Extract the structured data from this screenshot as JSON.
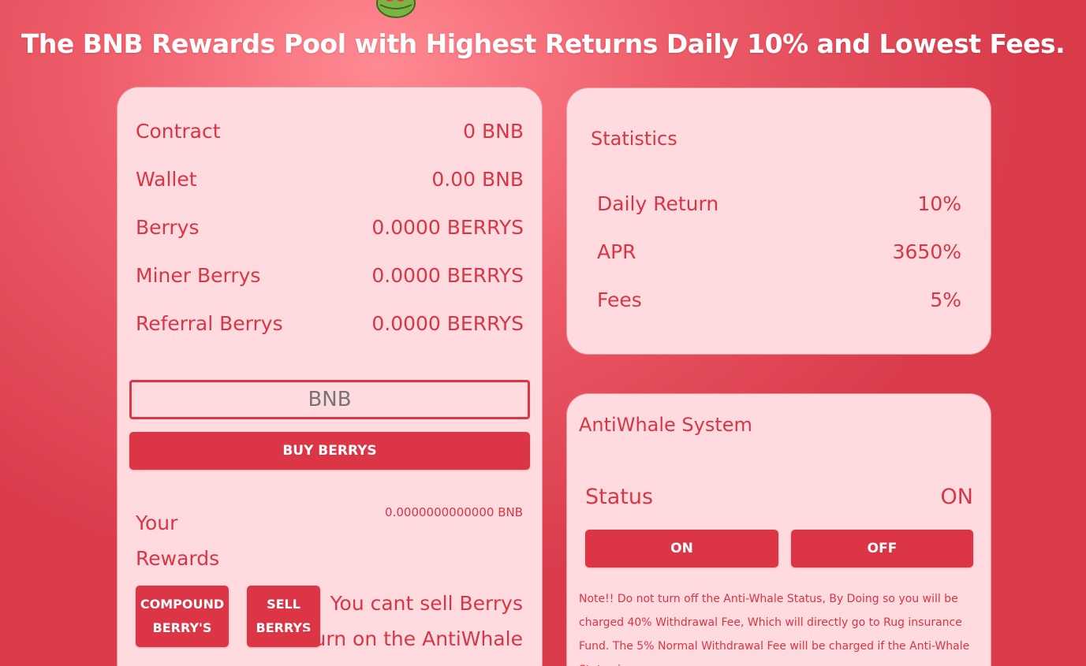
{
  "header": {
    "logo_icon": "berry-basket-logo-icon",
    "headline": "The BNB Rewards Pool with Highest Returns Daily 10% and Lowest Fees."
  },
  "main": {
    "rows": [
      {
        "label": "Contract",
        "value": "0 BNB"
      },
      {
        "label": "Wallet",
        "value": "0.00 BNB"
      },
      {
        "label": "Berrys",
        "value": "0.0000 BERRYS"
      },
      {
        "label": "Miner Berrys",
        "value": "0.0000 BERRYS"
      },
      {
        "label": "Referral Berrys",
        "value": "0.0000 BERRYS"
      }
    ],
    "bnb_input_placeholder": "BNB",
    "buy_button": "BUY BERRYS",
    "rewards_label": "Your Rewards",
    "rewards_value": "0.0000000000000 BNB",
    "compound_button": "COMPOUND BERRY'S",
    "sell_button": "SELL BERRYS",
    "sell_warning_line1": "You cant sell Berrys",
    "sell_warning_line2": "Turn on the AntiWhale"
  },
  "statistics": {
    "title": "Statistics",
    "rows": [
      {
        "label": "Daily Return",
        "value": "10%"
      },
      {
        "label": "APR",
        "value": "3650%"
      },
      {
        "label": "Fees",
        "value": "5%"
      }
    ]
  },
  "antiwhale": {
    "title": "AntiWhale System",
    "status_label": "Status",
    "status_value": "ON",
    "on_button": "ON",
    "off_button": "OFF",
    "note": "Note!! Do not turn off the Anti-Whale Status, By Doing so you will be charged 40% Withdrawal Fee, Which will directly go to Rug insurance Fund. The 5% Normal Withdrawal Fee will be charged if the Anti-Whale Status is on."
  },
  "colors": {
    "accent": "#dc3546",
    "card_bg": "#ffdbdf",
    "text": "#d83545"
  }
}
